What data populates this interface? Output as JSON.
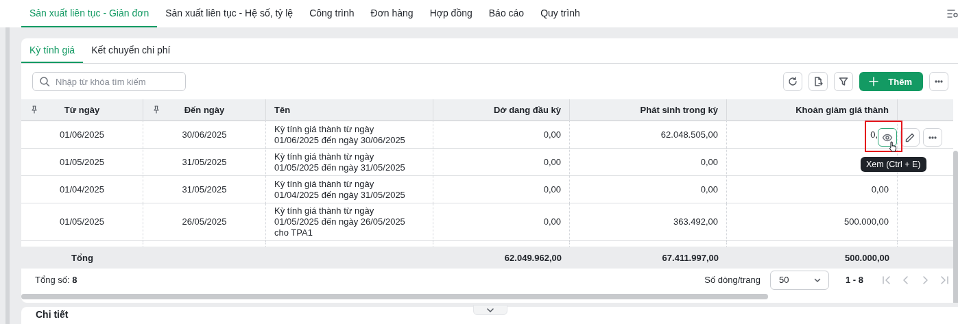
{
  "main_tabs": [
    {
      "label": "Sản xuất liên tục - Giản đơn",
      "selected": true
    },
    {
      "label": "Sản xuất liên tục - Hệ số, tỷ lệ",
      "selected": false
    },
    {
      "label": "Công trình",
      "selected": false
    },
    {
      "label": "Đơn hàng",
      "selected": false
    },
    {
      "label": "Hợp đồng",
      "selected": false
    },
    {
      "label": "Báo cáo",
      "selected": false
    },
    {
      "label": "Quy trình",
      "selected": false
    }
  ],
  "sub_tabs": [
    {
      "label": "Kỳ tính giá",
      "selected": true
    },
    {
      "label": "Kết chuyển chi phí",
      "selected": false
    }
  ],
  "search": {
    "placeholder": "Nhập từ khóa tìm kiếm"
  },
  "toolbar": {
    "add_button": "Thêm"
  },
  "table": {
    "columns": [
      {
        "label": "Từ ngày",
        "pinned": true
      },
      {
        "label": "Đến ngày",
        "pinned": true
      },
      {
        "label": "Tên",
        "pinned": false
      },
      {
        "label": "Dở dang đầu kỳ",
        "pinned": false
      },
      {
        "label": "Phát sinh trong kỳ",
        "pinned": false
      },
      {
        "label": "Khoản giảm giá thành",
        "pinned": false
      }
    ],
    "rows": [
      {
        "hovered": true,
        "cells": [
          "01/06/2025",
          "30/06/2025",
          "Kỳ tính giá thành từ ngày 01/06/2025 đến ngày 30/06/2025",
          "0,00",
          "62.048.505,00",
          "0,"
        ]
      },
      {
        "hovered": false,
        "cells": [
          "01/05/2025",
          "31/05/2025",
          "Kỳ tính giá thành từ ngày 01/05/2025 đến ngày 31/05/2025",
          "0,00",
          "0,00",
          ""
        ]
      },
      {
        "hovered": false,
        "cells": [
          "01/04/2025",
          "31/05/2025",
          "Kỳ tính giá thành từ ngày 01/04/2025 đến ngày 31/05/2025",
          "0,00",
          "0,00",
          "0,00"
        ]
      },
      {
        "hovered": false,
        "cells": [
          "01/05/2025",
          "26/05/2025",
          "Kỳ tính giá thành từ ngày 01/05/2025 đến ngày 26/05/2025 cho TPA1",
          "0,00",
          "363.492,00",
          "500.000,00"
        ]
      }
    ],
    "total": {
      "label": "Tổng",
      "values": [
        "62.049.962,00",
        "67.411.997,00",
        "500.000,00"
      ]
    }
  },
  "row_actions": {
    "tooltip": "Xem (Ctrl + E)"
  },
  "pager": {
    "total_label": "Tổng số:",
    "total": "8",
    "rows_per_page_label": "Số dòng/trang",
    "page_size": "50",
    "range": "1 - 8"
  },
  "detail_panel": {
    "title": "Chi tiết"
  }
}
